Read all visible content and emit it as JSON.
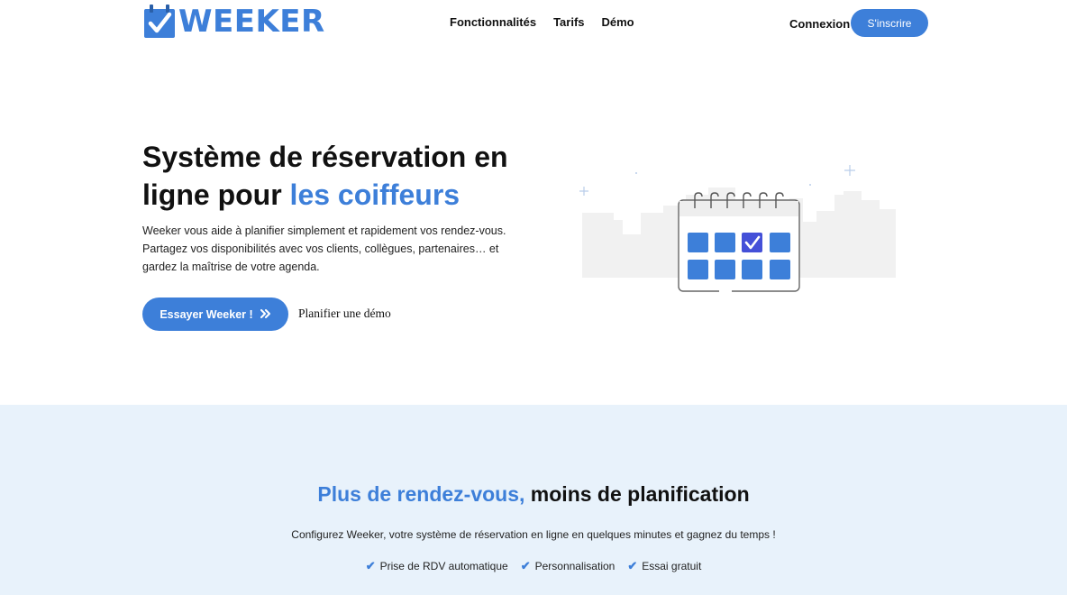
{
  "header": {
    "logo_text": "WEEKER",
    "nav": [
      "Fonctionnalités",
      "Tarifs",
      "Démo"
    ],
    "login_label": "Connexion",
    "signup_label": "S'inscrire"
  },
  "hero": {
    "title_part1": "Système de réservation en ligne pour ",
    "title_accent": "les coiffeurs",
    "description": "Weeker vous aide à planifier simplement et rapidement vos rendez-vous. Partagez vos disponibilités avec vos clients, collègues, partenaires… et gardez la maîtrise de votre agenda.",
    "cta_label": "Essayer Weeker !",
    "cta_icon": "double-chevron-right-icon",
    "demo_label": "Planifier une démo"
  },
  "section": {
    "title_accent": "Plus de rendez-vous,",
    "title_rest": " moins de planification",
    "description": "Configurez Weeker, votre système de réservation en ligne en quelques minutes et gagnez du temps !",
    "features": [
      "Prise de RDV automatique",
      "Personnalisation",
      "Essai gratuit"
    ]
  },
  "colors": {
    "accent": "#3d7fd9",
    "band_background": "#e8f2fb"
  }
}
